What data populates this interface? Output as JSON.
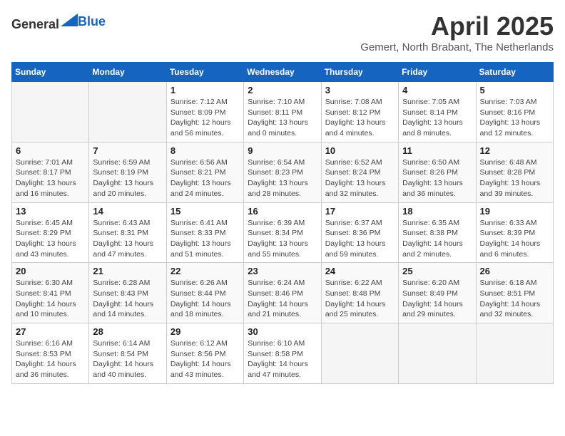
{
  "header": {
    "logo_general": "General",
    "logo_blue": "Blue",
    "month": "April 2025",
    "location": "Gemert, North Brabant, The Netherlands"
  },
  "weekdays": [
    "Sunday",
    "Monday",
    "Tuesday",
    "Wednesday",
    "Thursday",
    "Friday",
    "Saturday"
  ],
  "weeks": [
    [
      {
        "day": "",
        "info": ""
      },
      {
        "day": "",
        "info": ""
      },
      {
        "day": "1",
        "info": "Sunrise: 7:12 AM\nSunset: 8:09 PM\nDaylight: 12 hours\nand 56 minutes."
      },
      {
        "day": "2",
        "info": "Sunrise: 7:10 AM\nSunset: 8:11 PM\nDaylight: 13 hours\nand 0 minutes."
      },
      {
        "day": "3",
        "info": "Sunrise: 7:08 AM\nSunset: 8:12 PM\nDaylight: 13 hours\nand 4 minutes."
      },
      {
        "day": "4",
        "info": "Sunrise: 7:05 AM\nSunset: 8:14 PM\nDaylight: 13 hours\nand 8 minutes."
      },
      {
        "day": "5",
        "info": "Sunrise: 7:03 AM\nSunset: 8:16 PM\nDaylight: 13 hours\nand 12 minutes."
      }
    ],
    [
      {
        "day": "6",
        "info": "Sunrise: 7:01 AM\nSunset: 8:17 PM\nDaylight: 13 hours\nand 16 minutes."
      },
      {
        "day": "7",
        "info": "Sunrise: 6:59 AM\nSunset: 8:19 PM\nDaylight: 13 hours\nand 20 minutes."
      },
      {
        "day": "8",
        "info": "Sunrise: 6:56 AM\nSunset: 8:21 PM\nDaylight: 13 hours\nand 24 minutes."
      },
      {
        "day": "9",
        "info": "Sunrise: 6:54 AM\nSunset: 8:23 PM\nDaylight: 13 hours\nand 28 minutes."
      },
      {
        "day": "10",
        "info": "Sunrise: 6:52 AM\nSunset: 8:24 PM\nDaylight: 13 hours\nand 32 minutes."
      },
      {
        "day": "11",
        "info": "Sunrise: 6:50 AM\nSunset: 8:26 PM\nDaylight: 13 hours\nand 36 minutes."
      },
      {
        "day": "12",
        "info": "Sunrise: 6:48 AM\nSunset: 8:28 PM\nDaylight: 13 hours\nand 39 minutes."
      }
    ],
    [
      {
        "day": "13",
        "info": "Sunrise: 6:45 AM\nSunset: 8:29 PM\nDaylight: 13 hours\nand 43 minutes."
      },
      {
        "day": "14",
        "info": "Sunrise: 6:43 AM\nSunset: 8:31 PM\nDaylight: 13 hours\nand 47 minutes."
      },
      {
        "day": "15",
        "info": "Sunrise: 6:41 AM\nSunset: 8:33 PM\nDaylight: 13 hours\nand 51 minutes."
      },
      {
        "day": "16",
        "info": "Sunrise: 6:39 AM\nSunset: 8:34 PM\nDaylight: 13 hours\nand 55 minutes."
      },
      {
        "day": "17",
        "info": "Sunrise: 6:37 AM\nSunset: 8:36 PM\nDaylight: 13 hours\nand 59 minutes."
      },
      {
        "day": "18",
        "info": "Sunrise: 6:35 AM\nSunset: 8:38 PM\nDaylight: 14 hours\nand 2 minutes."
      },
      {
        "day": "19",
        "info": "Sunrise: 6:33 AM\nSunset: 8:39 PM\nDaylight: 14 hours\nand 6 minutes."
      }
    ],
    [
      {
        "day": "20",
        "info": "Sunrise: 6:30 AM\nSunset: 8:41 PM\nDaylight: 14 hours\nand 10 minutes."
      },
      {
        "day": "21",
        "info": "Sunrise: 6:28 AM\nSunset: 8:43 PM\nDaylight: 14 hours\nand 14 minutes."
      },
      {
        "day": "22",
        "info": "Sunrise: 6:26 AM\nSunset: 8:44 PM\nDaylight: 14 hours\nand 18 minutes."
      },
      {
        "day": "23",
        "info": "Sunrise: 6:24 AM\nSunset: 8:46 PM\nDaylight: 14 hours\nand 21 minutes."
      },
      {
        "day": "24",
        "info": "Sunrise: 6:22 AM\nSunset: 8:48 PM\nDaylight: 14 hours\nand 25 minutes."
      },
      {
        "day": "25",
        "info": "Sunrise: 6:20 AM\nSunset: 8:49 PM\nDaylight: 14 hours\nand 29 minutes."
      },
      {
        "day": "26",
        "info": "Sunrise: 6:18 AM\nSunset: 8:51 PM\nDaylight: 14 hours\nand 32 minutes."
      }
    ],
    [
      {
        "day": "27",
        "info": "Sunrise: 6:16 AM\nSunset: 8:53 PM\nDaylight: 14 hours\nand 36 minutes."
      },
      {
        "day": "28",
        "info": "Sunrise: 6:14 AM\nSunset: 8:54 PM\nDaylight: 14 hours\nand 40 minutes."
      },
      {
        "day": "29",
        "info": "Sunrise: 6:12 AM\nSunset: 8:56 PM\nDaylight: 14 hours\nand 43 minutes."
      },
      {
        "day": "30",
        "info": "Sunrise: 6:10 AM\nSunset: 8:58 PM\nDaylight: 14 hours\nand 47 minutes."
      },
      {
        "day": "",
        "info": ""
      },
      {
        "day": "",
        "info": ""
      },
      {
        "day": "",
        "info": ""
      }
    ]
  ]
}
